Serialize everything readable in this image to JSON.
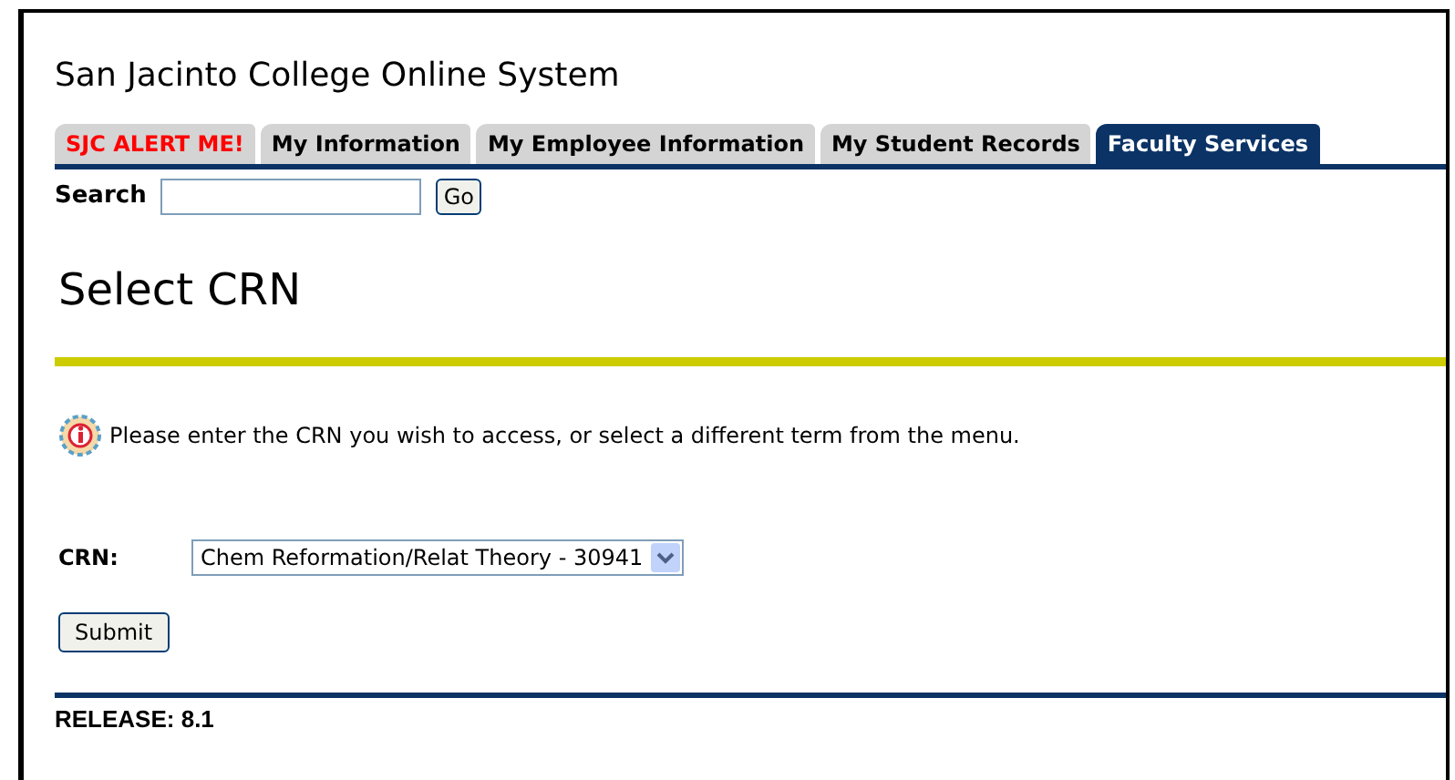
{
  "site_title": "San Jacinto College Online System",
  "tabs": [
    {
      "label": "SJC ALERT ME!",
      "kind": "alert",
      "selected": false
    },
    {
      "label": "My Information",
      "kind": "normal",
      "selected": false
    },
    {
      "label": "My Employee Information",
      "kind": "normal",
      "selected": false
    },
    {
      "label": "My Student Records",
      "kind": "normal",
      "selected": false
    },
    {
      "label": "Faculty Services",
      "kind": "normal",
      "selected": true
    }
  ],
  "search": {
    "label": "Search",
    "button": "Go"
  },
  "page_title": "Select CRN",
  "info": "Please enter the CRN you wish to access, or select a different term from the menu.",
  "crn": {
    "label": "CRN:",
    "value": "Chem Reformation/Relat Theory - 30941"
  },
  "submit": "Submit",
  "release": "RELEASE: 8.1"
}
